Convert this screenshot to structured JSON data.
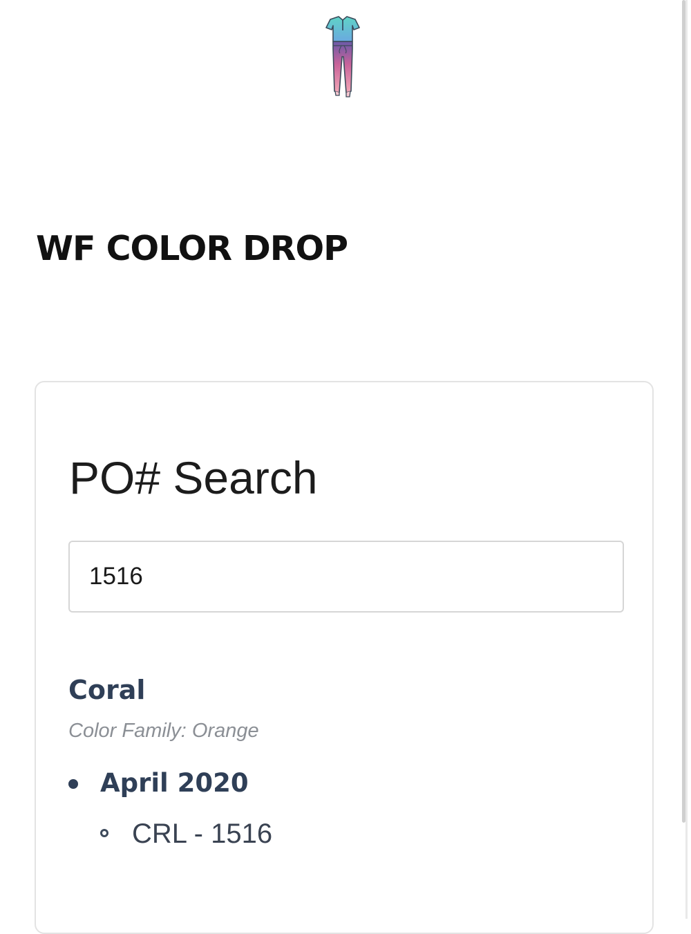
{
  "site": {
    "title": "WF COLOR DROP",
    "logo_icon": "scrubs-outfit-icon"
  },
  "search_card": {
    "title": "PO# Search",
    "input_value": "1516"
  },
  "result": {
    "color_name": "Coral",
    "color_family": "Color Family: Orange",
    "months": [
      {
        "label": "April 2020",
        "items": [
          "CRL - 1516"
        ]
      }
    ]
  },
  "colors": {
    "heading": "#111111",
    "result_text": "#2f3f57",
    "muted_text": "#8b8f95",
    "card_border": "#e3e3e3"
  }
}
